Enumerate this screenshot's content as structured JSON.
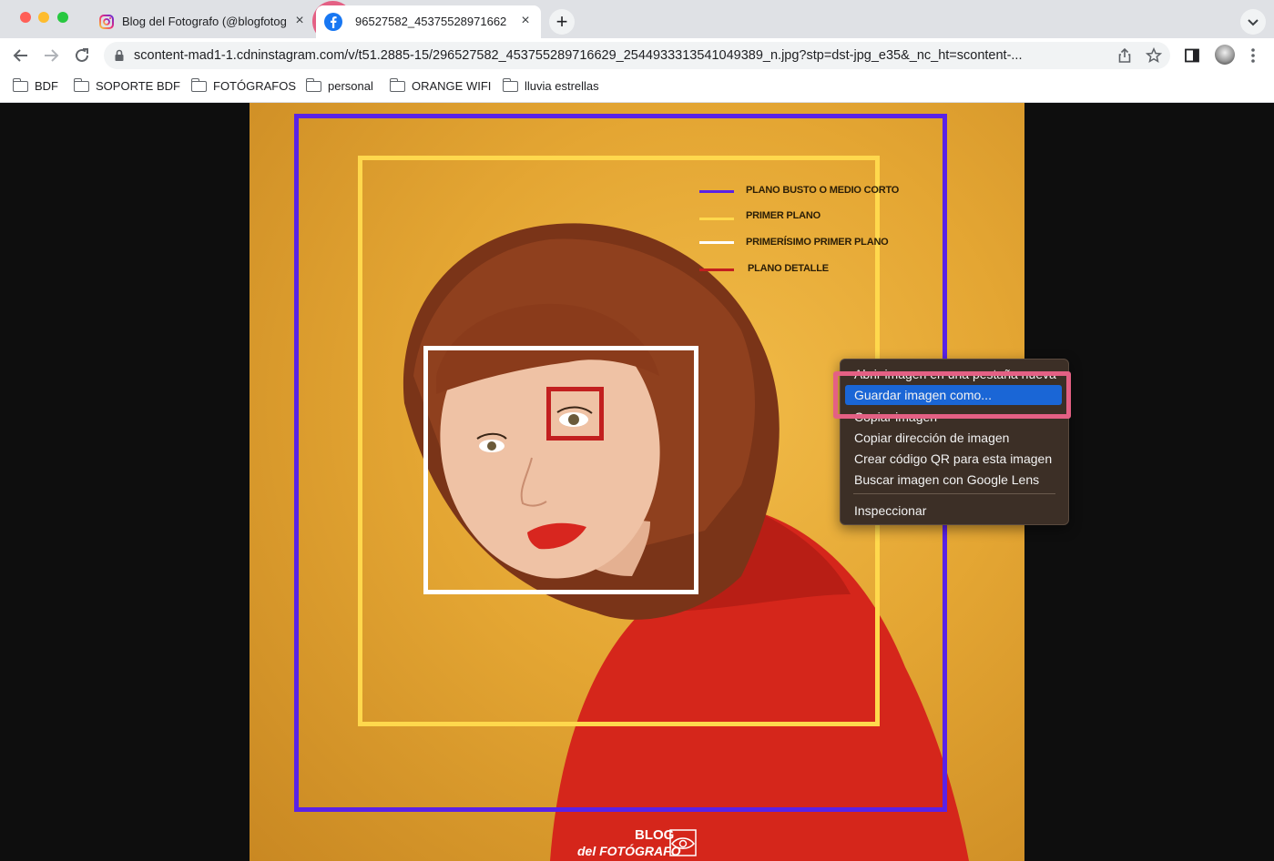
{
  "browser": {
    "tabs": [
      {
        "title": "Blog del Fotografo (@blogfotog",
        "close": "×"
      },
      {
        "title": "96527582_45375528971662",
        "close": "×"
      }
    ],
    "new_tab": "+",
    "url": "scontent-mad1-1.cdninstagram.com/v/t51.2885-15/296527582_453755289716629_2544933313541049389_n.jpg?stp=dst-jpg_e35&_nc_ht=scontent-...",
    "bookmarks": [
      "BDF",
      "SOPORTE BDF",
      "FOTÓGRAFOS",
      "personal",
      "ORANGE WIFI",
      "lluvia estrellas"
    ]
  },
  "image": {
    "legend": [
      {
        "label": "PLANO BUSTO O MEDIO CORTO",
        "color": "#5a22e6"
      },
      {
        "label": "PRIMER PLANO",
        "color": "#ffd84d"
      },
      {
        "label": "PRIMERÍSIMO PRIMER PLANO",
        "color": "#ffffff"
      },
      {
        "label": "PLANO DETALLE",
        "color": "#c21f1f"
      }
    ],
    "logo_top": "BLOG",
    "logo_bottom": "del FOTÓGRAFO"
  },
  "context_menu": {
    "items": [
      "Abrir imagen en una pestaña nueva",
      "Guardar imagen como...",
      "Copiar imagen",
      "Copiar dirección de imagen",
      "Crear código QR para esta imagen",
      "Buscar imagen con Google Lens",
      "Inspeccionar"
    ]
  },
  "colors": {
    "accent_highlight": "#e46084",
    "menu_selected": "#1a66d6"
  }
}
